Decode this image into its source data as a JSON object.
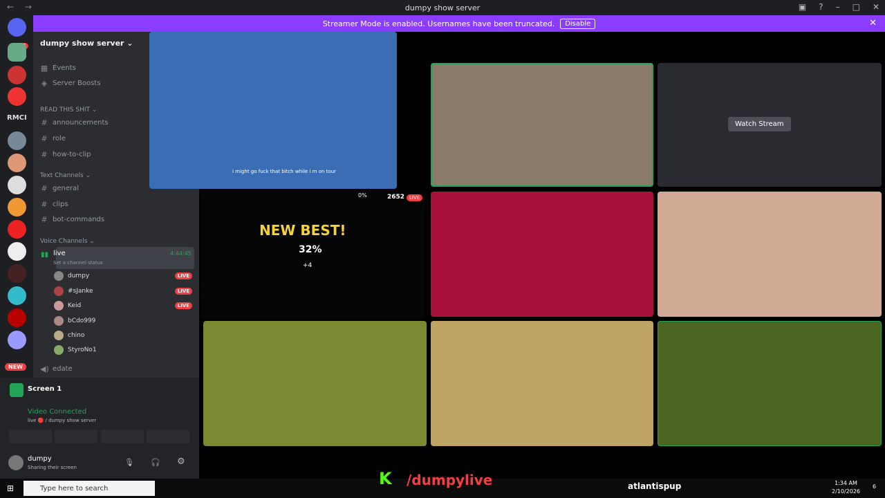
{
  "window": {
    "title": "dumpy show server"
  },
  "banner": {
    "text": "Streamer Mode is enabled. Usernames have been truncated.",
    "button": "Disable"
  },
  "guilds": {
    "badge": "685",
    "new": "NEW",
    "rmci": "RMCI"
  },
  "server": {
    "name": "dumpy show server ⌄"
  },
  "top_items": [
    "Events",
    "Server Boosts"
  ],
  "categories": {
    "read": "READ THIS SHIT ⌄",
    "text": "Text Channels ⌄",
    "voice": "Voice Channels ⌄"
  },
  "read_channels": [
    "announcements",
    "role",
    "how-to-clip"
  ],
  "text_channels": [
    "general",
    "clips",
    "bot-commands"
  ],
  "voice": {
    "channel": "live",
    "time": "4:44:45",
    "status": "Set a channel status",
    "other": "edate"
  },
  "users": [
    {
      "name": "dumpy",
      "live": true
    },
    {
      "name": "#sJanke",
      "live": true
    },
    {
      "name": "Keid",
      "live": true
    },
    {
      "name": "bCdo999",
      "live": false
    },
    {
      "name": "chino",
      "live": false
    },
    {
      "name": "StyroNo1",
      "live": false
    }
  ],
  "live_label": "LIVE",
  "panel": {
    "screen": "Screen 1",
    "connected": "Video Connected",
    "sub": "live 🔴 / dumpy show server",
    "user": "dumpy",
    "user_status": "Sharing their screen"
  },
  "stage": {
    "subtitle": "i might go fuck that bitch while i m on tour",
    "game_title": "NEW BEST!",
    "percent": "32%",
    "plus": "+4",
    "progress": "0%",
    "count": "2652",
    "watch": "Watch Stream"
  },
  "taskbar": {
    "search": "Type here to search",
    "streamer": "atlantispup",
    "overlay": "/dumpylive",
    "time": "1:34 AM",
    "date": "2/10/2026",
    "notif": "6"
  }
}
